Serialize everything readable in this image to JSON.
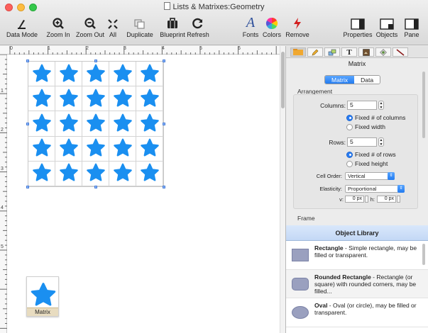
{
  "window": {
    "title": "Lists & Matrixes:Geometry"
  },
  "toolbar": {
    "data_mode": "Data Mode",
    "zoom_in": "Zoom In",
    "zoom_out": "Zoom Out",
    "all": "All",
    "duplicate": "Duplicate",
    "blueprint": "Blueprint",
    "refresh": "Refresh",
    "fonts": "Fonts",
    "colors": "Colors",
    "remove": "Remove",
    "properties": "Properties",
    "objects": "Objects",
    "pane": "Pane"
  },
  "ruler": {
    "top": [
      "0",
      "1",
      "2",
      "3",
      "4",
      "5",
      "6"
    ],
    "left": [
      "1",
      "2",
      "3",
      "4",
      "5"
    ]
  },
  "canvas": {
    "matrix": {
      "columns": 5,
      "rows": 5,
      "star_color": "#1a8ff0"
    },
    "chip_label": "Matrix"
  },
  "inspector": {
    "title": "Matrix",
    "segments": [
      "Matrix",
      "Data"
    ],
    "arrangement_label": "Arrangement",
    "columns_label": "Columns:",
    "columns_value": "5",
    "fixed_columns": "Fixed # of columns",
    "fixed_width": "Fixed width",
    "rows_label": "Rows:",
    "rows_value": "5",
    "fixed_rows": "Fixed # of rows",
    "fixed_height": "Fixed height",
    "cell_order_label": "Cell Order:",
    "cell_order_value": "Vertical",
    "elasticity_label": "Elasticity:",
    "elasticity_value": "Proportional",
    "v_label": "v:",
    "v_value": "0 px",
    "h_label": "h:",
    "h_value": "0 px",
    "frame_label": "Frame"
  },
  "object_library": {
    "title": "Object Library",
    "items": [
      {
        "name": "Rectangle",
        "desc": " - Simple rectangle, may be filled or transparent."
      },
      {
        "name": "Rounded Rectangle",
        "desc": " - Rectangle (or square) with rounded corners, may be filled..."
      },
      {
        "name": "Oval",
        "desc": " - Oval (or circle), may be filled or transparent."
      }
    ]
  }
}
